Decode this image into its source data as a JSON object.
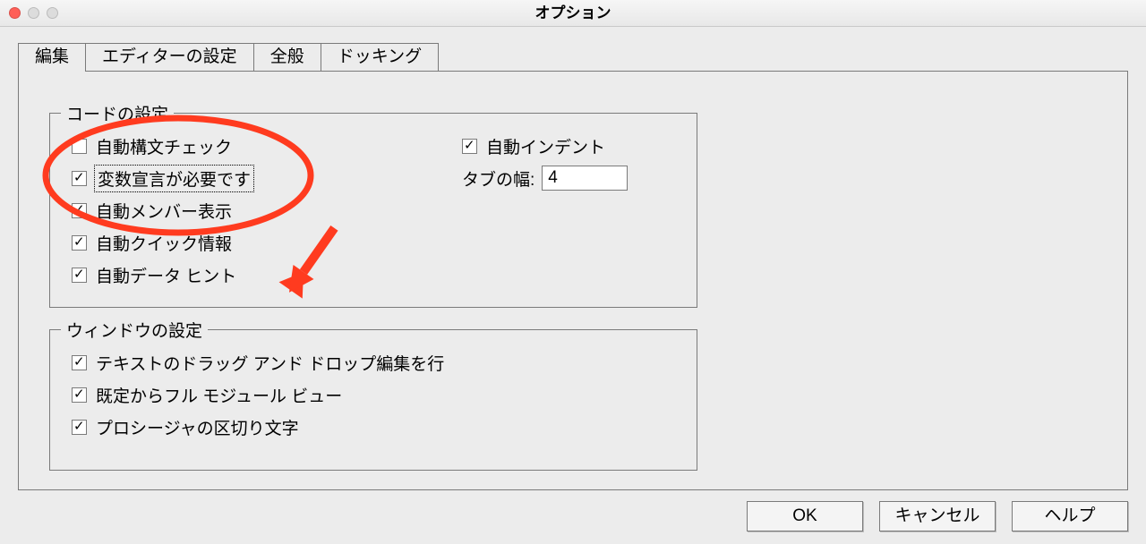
{
  "window": {
    "title": "オプション"
  },
  "tabs": {
    "edit": "編集",
    "editor": "エディターの設定",
    "general": "全般",
    "docking": "ドッキング"
  },
  "code_group": {
    "title": "コードの設定",
    "auto_syntax_check": "自動構文チェック",
    "require_var_decl": "変数宣言が必要です",
    "auto_list_members": "自動メンバー表示",
    "auto_quick_info": "自動クイック情報",
    "auto_data_tips": "自動データ ヒント",
    "auto_indent": "自動インデント",
    "tab_width_label": "タブの幅:",
    "tab_width_value": "4"
  },
  "window_group": {
    "title": "ウィンドウの設定",
    "drag_drop_edit": "テキストのドラッグ アンド ドロップ編集を行",
    "full_module_view": "既定からフル モジュール ビュー",
    "proc_separator": "プロシージャの区切り文字"
  },
  "buttons": {
    "ok": "OK",
    "cancel": "キャンセル",
    "help": "ヘルプ"
  },
  "checked": {
    "auto_syntax_check": false,
    "require_var_decl": true,
    "auto_list_members": true,
    "auto_quick_info": true,
    "auto_data_tips": true,
    "auto_indent": true,
    "drag_drop_edit": true,
    "full_module_view": true,
    "proc_separator": true
  },
  "annotation": {
    "color": "#ff3b1f"
  }
}
